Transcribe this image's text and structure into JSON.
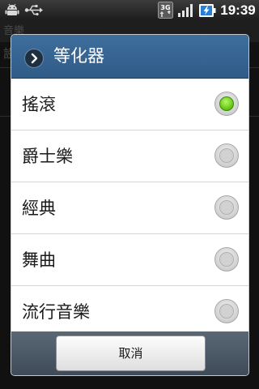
{
  "status_bar": {
    "time": "19:39",
    "network_label": "3G",
    "icons": [
      "android-debug-icon",
      "usb-icon",
      "3g-data-icon",
      "signal-strength-icon",
      "battery-charging-icon"
    ]
  },
  "background_app": {
    "title": "音樂",
    "row_text": "設"
  },
  "dialog": {
    "title": "等化器",
    "header_icon": "chevron-right-icon",
    "options": [
      {
        "label": "搖滾",
        "selected": true
      },
      {
        "label": "爵士樂",
        "selected": false
      },
      {
        "label": "經典",
        "selected": false
      },
      {
        "label": "舞曲",
        "selected": false
      },
      {
        "label": "流行音樂",
        "selected": false
      }
    ],
    "cancel_label": "取消"
  },
  "colors": {
    "header_blue": "#3a6896",
    "selected_green": "#6fd11c",
    "dialog_frame": "#3c4a57"
  }
}
